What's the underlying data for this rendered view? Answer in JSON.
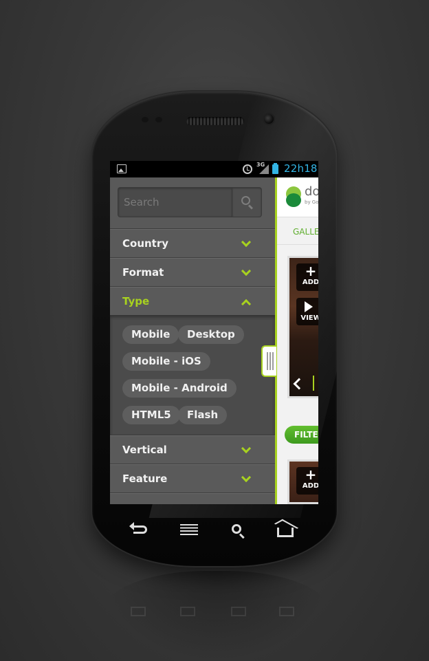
{
  "status_bar": {
    "network_label": "3G",
    "clock": "22h18",
    "accent_color": "#33b5e5"
  },
  "drawer": {
    "search": {
      "placeholder": "Search",
      "button_icon": "search-icon"
    },
    "categories": [
      {
        "label": "Country",
        "state": "collapsed"
      },
      {
        "label": "Format",
        "state": "collapsed"
      },
      {
        "label": "Type",
        "state": "expanded"
      },
      {
        "label": "Vertical",
        "state": "collapsed"
      },
      {
        "label": "Feature",
        "state": "collapsed"
      }
    ],
    "type_tags": [
      "Mobile",
      "Desktop",
      "Mobile - iOS",
      "Mobile - Android",
      "HTML5",
      "Flash"
    ],
    "accent_color": "#a8d21f"
  },
  "content": {
    "logo_text": "do",
    "logo_sub": "by Go",
    "gallery_tab": "GALLE",
    "card1": {
      "add_label": "ADD",
      "view_label": "VIEW"
    },
    "filter_button": "FILTER",
    "card2": {
      "add_label": "ADD"
    }
  },
  "nav_bar": {
    "icons": [
      "back-icon",
      "menu-icon",
      "search-icon",
      "home-icon"
    ]
  }
}
